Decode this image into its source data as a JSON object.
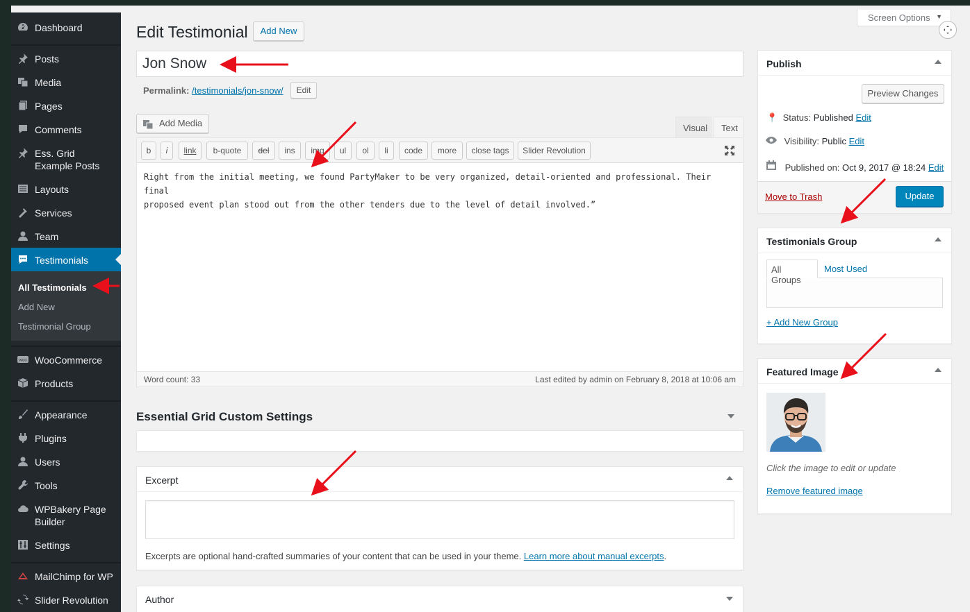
{
  "sidebar": {
    "items": [
      {
        "label": "Dashboard",
        "icon": "dashboard-icon"
      },
      {
        "label": "Posts",
        "icon": "pin-icon"
      },
      {
        "label": "Media",
        "icon": "media-icon"
      },
      {
        "label": "Pages",
        "icon": "page-icon"
      },
      {
        "label": "Comments",
        "icon": "comment-icon"
      },
      {
        "label": "Ess. Grid Example Posts",
        "icon": "pin-icon"
      },
      {
        "label": "Layouts",
        "icon": "layouts-icon"
      },
      {
        "label": "Services",
        "icon": "hammer-icon"
      },
      {
        "label": "Team",
        "icon": "user-icon"
      },
      {
        "label": "Testimonials",
        "icon": "speech-bubble-icon"
      },
      {
        "label": "WooCommerce",
        "icon": "woo-icon"
      },
      {
        "label": "Products",
        "icon": "box-icon"
      },
      {
        "label": "Appearance",
        "icon": "brush-icon"
      },
      {
        "label": "Plugins",
        "icon": "plug-icon"
      },
      {
        "label": "Users",
        "icon": "users-icon"
      },
      {
        "label": "Tools",
        "icon": "wrench-icon"
      },
      {
        "label": "WPBakery Page Builder",
        "icon": "cloud-icon"
      },
      {
        "label": "Settings",
        "icon": "sliders-icon"
      },
      {
        "label": "MailChimp for WP",
        "icon": "mailchimp-icon"
      },
      {
        "label": "Slider Revolution",
        "icon": "refresh-icon"
      }
    ],
    "submenu": [
      "All Testimonials",
      "Add New",
      "Testimonial Group"
    ]
  },
  "header": {
    "title": "Edit Testimonial",
    "add_new": "Add New",
    "screen_options": "Screen Options"
  },
  "post": {
    "title": "Jon Snow",
    "permalink_label": "Permalink:",
    "permalink_url": "/testimonials/jon-snow/",
    "permalink_edit": "Edit"
  },
  "editor": {
    "add_media": "Add Media",
    "tab_visual": "Visual",
    "tab_text": "Text",
    "buttons": [
      "b",
      "i",
      "link",
      "b-quote",
      "del",
      "ins",
      "img",
      "ul",
      "ol",
      "li",
      "code",
      "more",
      "close tags",
      "Slider Revolution"
    ],
    "content_line1": "Right from the initial meeting, we found PartyMaker to be very organized, detail-oriented and professional. Their final",
    "content_line2": "proposed event plan stood out from the other tenders due to the level of detail involved.”",
    "word_count": "Word count: 33",
    "last_edited": "Last edited by admin on February 8, 2018 at 10:06 am"
  },
  "essential_grid": {
    "title": "Essential Grid Custom Settings"
  },
  "excerpt": {
    "title": "Excerpt",
    "help": "Excerpts are optional hand-crafted summaries of your content that can be used in your theme.",
    "learn_more": "Learn more about manual excerpts",
    "period": "."
  },
  "author": {
    "title": "Author"
  },
  "publish": {
    "title": "Publish",
    "preview": "Preview Changes",
    "status_label": "Status:",
    "status_value": "Published",
    "visibility_label": "Visibility:",
    "visibility_value": "Public",
    "published_label": "Published on:",
    "published_value": "Oct 9, 2017 @ 18:24",
    "edit": "Edit",
    "trash": "Move to Trash",
    "update": "Update"
  },
  "testimonials_group": {
    "title": "Testimonials Group",
    "tab_all": "All Groups",
    "tab_most_used": "Most Used",
    "add_new": "+ Add New Group"
  },
  "featured_image": {
    "title": "Featured Image",
    "hint": "Click the image to edit or update",
    "remove": "Remove featured image"
  },
  "colors": {
    "primary": "#0073aa",
    "sidebar": "#23282d",
    "annotation": "#e8111b"
  }
}
